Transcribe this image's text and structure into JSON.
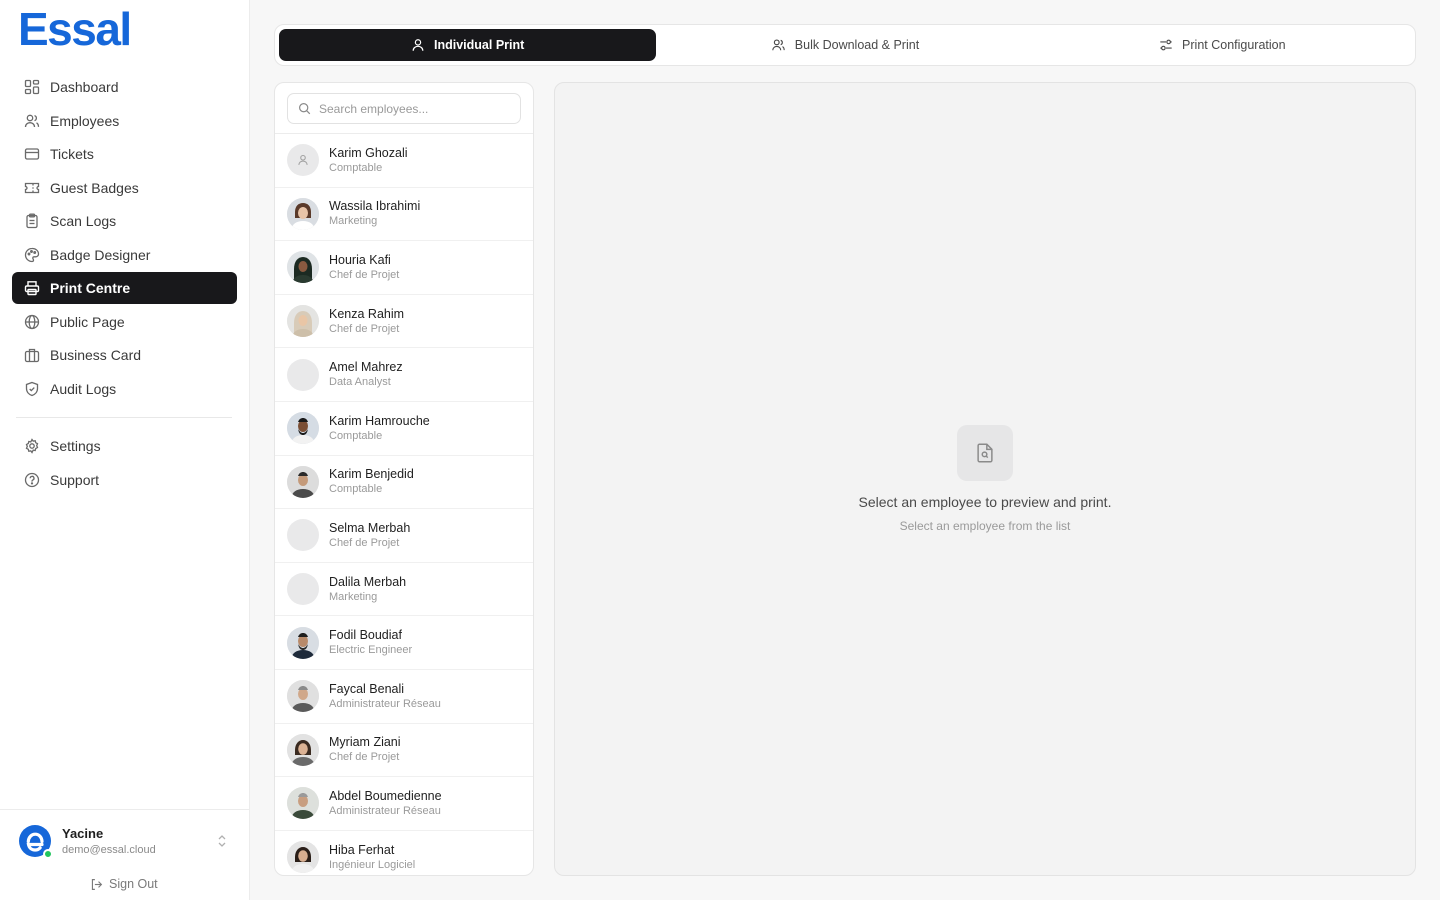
{
  "brand": {
    "logo_text": "Essal",
    "color": "#1667d9"
  },
  "nav": [
    {
      "label": "Dashboard",
      "icon": "dashboard-icon",
      "active": false
    },
    {
      "label": "Employees",
      "icon": "users-icon",
      "active": false
    },
    {
      "label": "Tickets",
      "icon": "card-icon",
      "active": false
    },
    {
      "label": "Guest Badges",
      "icon": "ticket-icon",
      "active": false
    },
    {
      "label": "Scan Logs",
      "icon": "clipboard-icon",
      "active": false
    },
    {
      "label": "Badge Designer",
      "icon": "palette-icon",
      "active": false
    },
    {
      "label": "Print Centre",
      "icon": "printer-icon",
      "active": true
    },
    {
      "label": "Public Page",
      "icon": "globe-icon",
      "active": false
    },
    {
      "label": "Business Card",
      "icon": "briefcase-icon",
      "active": false
    },
    {
      "label": "Audit Logs",
      "icon": "shield-icon",
      "active": false
    }
  ],
  "nav_secondary": [
    {
      "label": "Settings",
      "icon": "gear-icon"
    },
    {
      "label": "Support",
      "icon": "help-icon"
    }
  ],
  "user": {
    "name": "Yacine",
    "email": "demo@essal.cloud",
    "status_color": "#22c55e",
    "sign_out": "Sign Out"
  },
  "tabs": [
    {
      "label": "Individual Print",
      "icon": "user-icon",
      "active": true
    },
    {
      "label": "Bulk Download & Print",
      "icon": "users-icon",
      "active": false
    },
    {
      "label": "Print Configuration",
      "icon": "sliders-icon",
      "active": false
    }
  ],
  "search": {
    "placeholder": "Search employees...",
    "value": ""
  },
  "employees": [
    {
      "name": "Karim Ghozali",
      "role": "Comptable",
      "avatar": "placeholder"
    },
    {
      "name": "Wassila Ibrahimi",
      "role": "Marketing",
      "avatar": "photo"
    },
    {
      "name": "Houria Kafi",
      "role": "Chef de Projet",
      "avatar": "photo"
    },
    {
      "name": "Kenza Rahim",
      "role": "Chef de Projet",
      "avatar": "photo"
    },
    {
      "name": "Amel Mahrez",
      "role": "Data Analyst",
      "avatar": "empty"
    },
    {
      "name": "Karim Hamrouche",
      "role": "Comptable",
      "avatar": "photo"
    },
    {
      "name": "Karim Benjedid",
      "role": "Comptable",
      "avatar": "photo"
    },
    {
      "name": "Selma Merbah",
      "role": "Chef de Projet",
      "avatar": "empty"
    },
    {
      "name": "Dalila Merbah",
      "role": "Marketing",
      "avatar": "empty"
    },
    {
      "name": "Fodil Boudiaf",
      "role": "Electric Engineer",
      "avatar": "photo"
    },
    {
      "name": "Faycal Benali",
      "role": "Administrateur Réseau",
      "avatar": "photo"
    },
    {
      "name": "Myriam Ziani",
      "role": "Chef de Projet",
      "avatar": "photo"
    },
    {
      "name": "Abdel Boumedienne",
      "role": "Administrateur Réseau",
      "avatar": "photo"
    },
    {
      "name": "Hiba Ferhat",
      "role": "Ingénieur Logiciel",
      "avatar": "photo"
    }
  ],
  "preview": {
    "title": "Select an employee to preview and print.",
    "subtitle": "Select an employee from the list",
    "icon": "file-search-icon"
  }
}
